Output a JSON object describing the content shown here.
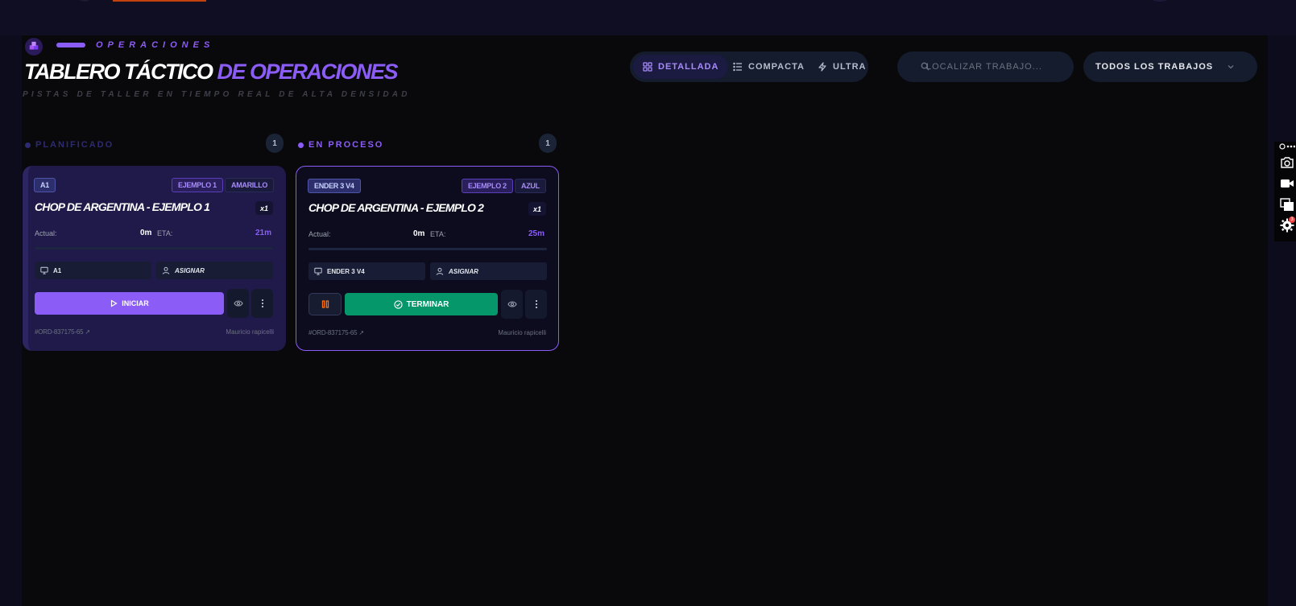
{
  "header": {
    "kicker": "OPERACIONES",
    "title_main": "TABLERO TÁCTICO",
    "title_accent": "DE OPERACIONES",
    "subtitle": "PISTAS DE TALLER EN TIEMPO REAL DE ALTA DENSIDAD"
  },
  "views": {
    "detailed": "DETALLADA",
    "compact": "COMPACTA",
    "ultra": "ULTRA",
    "active": "detailed"
  },
  "search": {
    "placeholder": "LOCALIZAR TRABAJO..."
  },
  "filter": {
    "selected": "TODOS LOS TRABAJOS"
  },
  "columns": [
    {
      "label": "PLANIFICADO",
      "count": "1",
      "dot_color": "#2e2a72",
      "label_color": "#2e2a72"
    },
    {
      "label": "EN PROCESO",
      "count": "1",
      "dot_color": "#8b5cf6",
      "label_color": "#8b5cf6"
    }
  ],
  "cards": [
    {
      "machine": "A1",
      "example_tag": "EJEMPLO 1",
      "color_tag": "AMARILLO",
      "title": "CHOP DE ARGENTINA - EJEMPLO 1",
      "qty": "x1",
      "actual_label": "Actual:",
      "actual_value": "0m",
      "eta_label": "ETA:",
      "eta_value": "21m",
      "machine_field": "A1",
      "assign_label": "ASIGNAR",
      "primary_action": "INICIAR",
      "order_id": "#ORD-837175-65",
      "operator": "Mauricio rapicelli"
    },
    {
      "machine": "ENDER 3 V4",
      "example_tag": "EJEMPLO 2",
      "color_tag": "AZUL",
      "title": "CHOP DE ARGENTINA - EJEMPLO 2",
      "qty": "x1",
      "actual_label": "Actual:",
      "actual_value": "0m",
      "eta_label": "ETA:",
      "eta_value": "25m",
      "machine_field": "ENDER 3 V4",
      "assign_label": "ASIGNAR",
      "primary_action": "TERMINAR",
      "order_id": "#ORD-837175-65",
      "operator": "Mauricio rapicelli"
    }
  ],
  "colors": {
    "accent": "#8b5cf6",
    "success": "#059669",
    "warning": "#f97316",
    "background": "#09090b"
  },
  "icons": {
    "brand": "cube-stack-icon",
    "detailed": "grid-icon",
    "compact": "list-icon",
    "ultra": "bolt-icon",
    "search": "search-icon",
    "filter": "chevron-down-icon",
    "machine": "monitor-icon",
    "assign": "user-icon",
    "start": "play-icon",
    "finish": "check-circle-icon",
    "pause": "pause-icon",
    "view": "eye-icon",
    "more": "more-vertical-icon"
  },
  "extension_bar": {
    "notification_count": "3"
  }
}
